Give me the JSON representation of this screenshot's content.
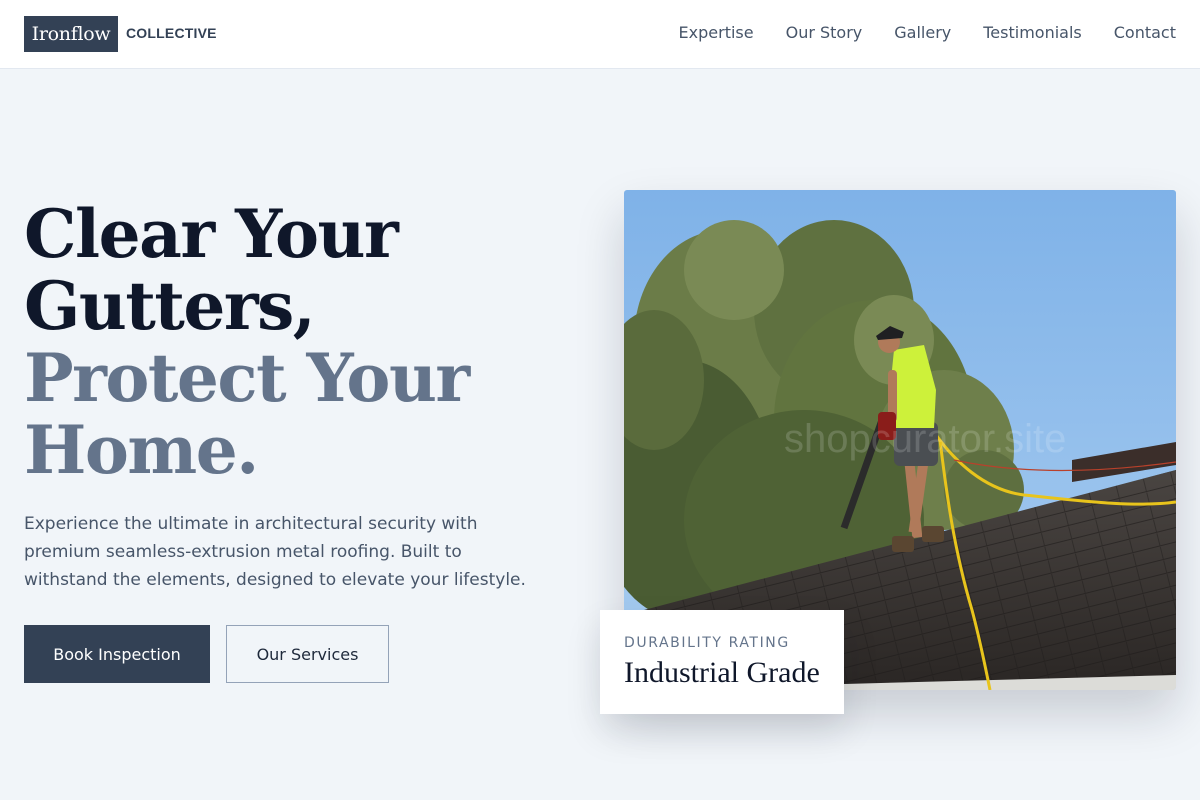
{
  "brand": {
    "name": "Ironflow",
    "subtitle": "COLLECTIVE"
  },
  "nav": {
    "items": [
      "Expertise",
      "Our Story",
      "Gallery",
      "Testimonials",
      "Contact"
    ]
  },
  "hero": {
    "headline_line1": "Clear Your",
    "headline_line2": "Gutters,",
    "headline_line3": "Protect Your",
    "headline_line4": "Home.",
    "description": "Experience the ultimate in architectural security with premium seamless-extrusion metal roofing. Built to withstand the elements, designed to elevate your lifestyle.",
    "primary_button": "Book Inspection",
    "secondary_button": "Our Services"
  },
  "image": {
    "subject": "worker on shingle roof with safety harness near large oak tree"
  },
  "rating_card": {
    "label": "DURABILITY RATING",
    "value": "Industrial Grade"
  },
  "colors": {
    "accent": "#334155",
    "headline_dark": "#0f172a",
    "headline_muted": "#64748b",
    "background": "#f1f5f9"
  }
}
